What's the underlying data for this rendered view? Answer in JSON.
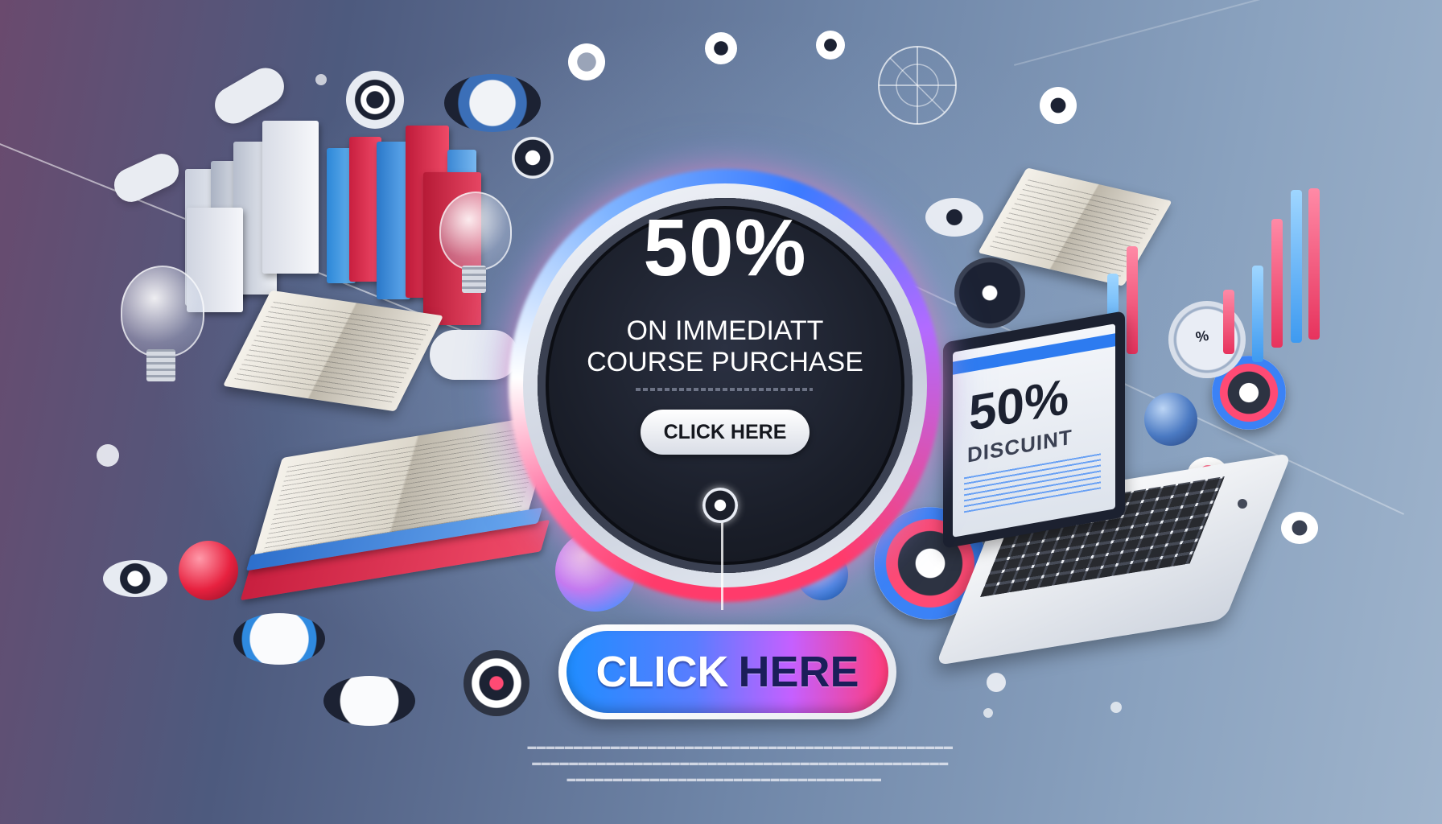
{
  "promo": {
    "headline": "50%",
    "subline_1": "ON IMMEDIATT",
    "subline_2": "COURSE PURCHASE",
    "small_button_label": "CLICK HERE",
    "cta_click": "CLICK",
    "cta_here": "HERE"
  },
  "laptop": {
    "screen_big": "50%",
    "screen_small": "DISCUINT"
  },
  "badge": {
    "label": "%"
  },
  "colors": {
    "accent_pink": "#ff3b7a",
    "accent_blue": "#1f8dff",
    "accent_purple": "#c560ff",
    "circle_dark": "#1a1e29"
  }
}
